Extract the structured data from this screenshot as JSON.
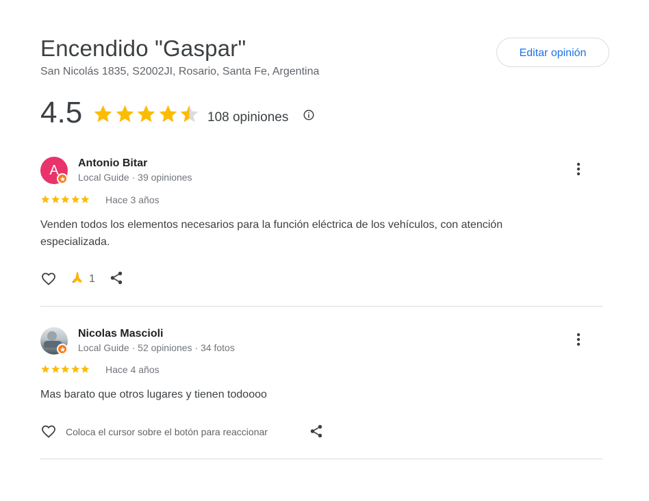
{
  "place": {
    "name": "Encendido \"Gaspar\"",
    "address": "San Nicolás 1835, S2002JI, Rosario, Santa Fe, Argentina",
    "edit_button_label": "Editar opinión",
    "rating": "4.5",
    "rating_value": 4.5,
    "review_count_label": "108 opiniones",
    "star_color": "#fbbc04",
    "empty_star_color": "#dadce0"
  },
  "reviews": [
    {
      "avatar_letter": "A",
      "avatar_color": "#e8336b",
      "name": "Antonio Bitar",
      "meta": "Local Guide · 39 opiniones",
      "stars": 5,
      "time": "Hace 3 años",
      "text": "Venden todos los elementos necesarios para la función eléctrica de los vehículos, con atención especializada.",
      "reaction_count": "1"
    },
    {
      "name": "Nicolas Mascioli",
      "meta": "Local Guide · 52 opiniones · 34 fotos",
      "stars": 5,
      "time": "Hace 4 años",
      "text": "Mas barato que otros lugares y tienen todoooo",
      "reaction_hint": "Coloca el cursor sobre el botón para reaccionar"
    }
  ],
  "icons": {
    "more": "more-vert-icon",
    "like": "heart-icon",
    "share": "share-icon",
    "info": "info-icon",
    "reaction": "pray-emoji-icon",
    "guide": "local-guide-star-icon"
  }
}
